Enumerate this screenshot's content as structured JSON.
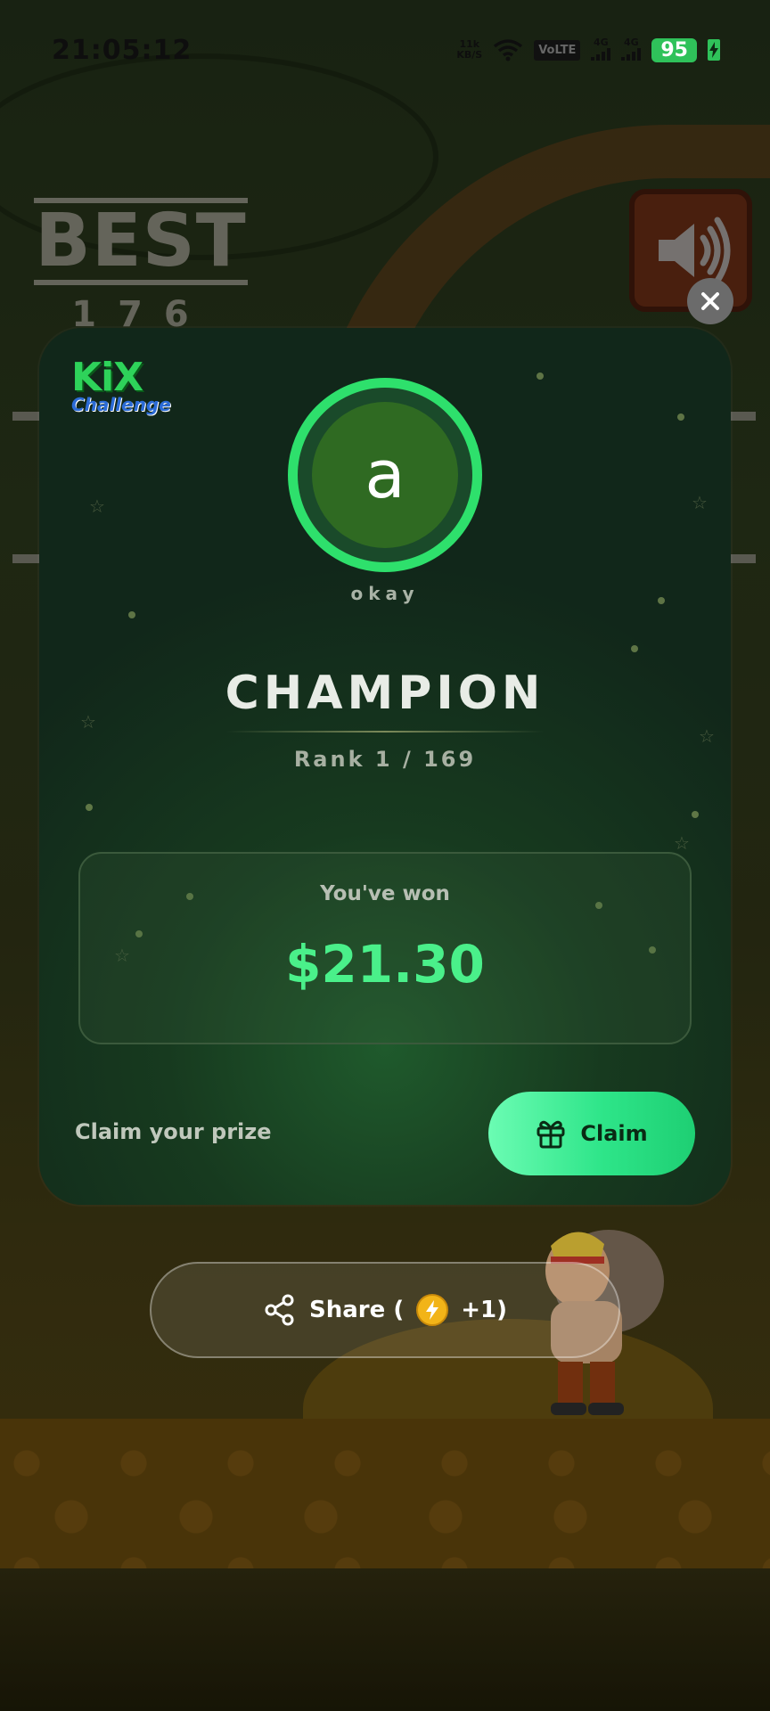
{
  "status_bar": {
    "time": "21:05:12",
    "net_speed_top": "11k",
    "net_speed_bottom": "KB/S",
    "volte": "VoLTE",
    "signal_1": "4G",
    "signal_2": "4G",
    "battery": "95"
  },
  "game_bg": {
    "best_label": "BEST",
    "best_value": "176"
  },
  "modal": {
    "logo_top": "KiX",
    "logo_bottom": "Challenge",
    "avatar_letter": "a",
    "username": "okay",
    "rank_title": "CHAMPION",
    "rank_line": "Rank 1 / 169",
    "prize_label": "You've won",
    "prize_amount": "$21.30",
    "claim_prompt": "Claim your prize",
    "claim_button": "Claim"
  },
  "share": {
    "label_prefix": "Share (",
    "label_suffix": "+1)"
  },
  "icons": {
    "close": "close-icon",
    "sound": "speaker-icon",
    "gift": "gift-icon",
    "share": "share-icon",
    "coin": "lightning-coin-icon"
  },
  "colors": {
    "accent_green": "#2ee589",
    "prize_green": "#4af08a",
    "card_bg": "#173a1f",
    "battery_green": "#2fc25a"
  }
}
